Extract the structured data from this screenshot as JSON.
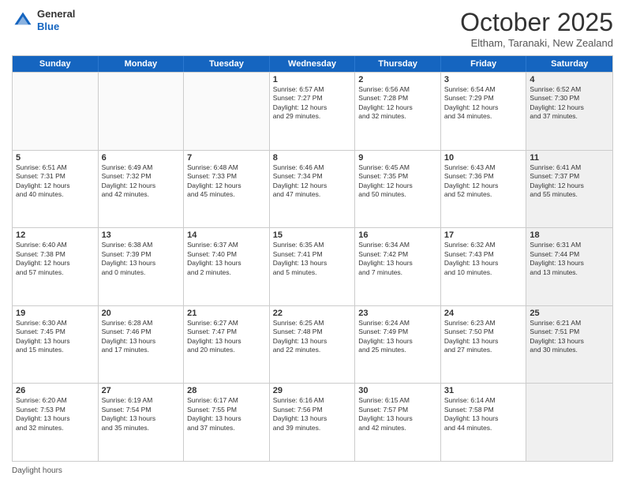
{
  "header": {
    "logo_general": "General",
    "logo_blue": "Blue",
    "month_title": "October 2025",
    "subtitle": "Eltham, Taranaki, New Zealand"
  },
  "days_of_week": [
    "Sunday",
    "Monday",
    "Tuesday",
    "Wednesday",
    "Thursday",
    "Friday",
    "Saturday"
  ],
  "footer_text": "Daylight hours",
  "weeks": [
    [
      {
        "day": "",
        "info": "",
        "empty": true
      },
      {
        "day": "",
        "info": "",
        "empty": true
      },
      {
        "day": "",
        "info": "",
        "empty": true
      },
      {
        "day": "1",
        "info": "Sunrise: 6:57 AM\nSunset: 7:27 PM\nDaylight: 12 hours\nand 29 minutes."
      },
      {
        "day": "2",
        "info": "Sunrise: 6:56 AM\nSunset: 7:28 PM\nDaylight: 12 hours\nand 32 minutes."
      },
      {
        "day": "3",
        "info": "Sunrise: 6:54 AM\nSunset: 7:29 PM\nDaylight: 12 hours\nand 34 minutes."
      },
      {
        "day": "4",
        "info": "Sunrise: 6:52 AM\nSunset: 7:30 PM\nDaylight: 12 hours\nand 37 minutes.",
        "shaded": true
      }
    ],
    [
      {
        "day": "5",
        "info": "Sunrise: 6:51 AM\nSunset: 7:31 PM\nDaylight: 12 hours\nand 40 minutes."
      },
      {
        "day": "6",
        "info": "Sunrise: 6:49 AM\nSunset: 7:32 PM\nDaylight: 12 hours\nand 42 minutes."
      },
      {
        "day": "7",
        "info": "Sunrise: 6:48 AM\nSunset: 7:33 PM\nDaylight: 12 hours\nand 45 minutes."
      },
      {
        "day": "8",
        "info": "Sunrise: 6:46 AM\nSunset: 7:34 PM\nDaylight: 12 hours\nand 47 minutes."
      },
      {
        "day": "9",
        "info": "Sunrise: 6:45 AM\nSunset: 7:35 PM\nDaylight: 12 hours\nand 50 minutes."
      },
      {
        "day": "10",
        "info": "Sunrise: 6:43 AM\nSunset: 7:36 PM\nDaylight: 12 hours\nand 52 minutes."
      },
      {
        "day": "11",
        "info": "Sunrise: 6:41 AM\nSunset: 7:37 PM\nDaylight: 12 hours\nand 55 minutes.",
        "shaded": true
      }
    ],
    [
      {
        "day": "12",
        "info": "Sunrise: 6:40 AM\nSunset: 7:38 PM\nDaylight: 12 hours\nand 57 minutes."
      },
      {
        "day": "13",
        "info": "Sunrise: 6:38 AM\nSunset: 7:39 PM\nDaylight: 13 hours\nand 0 minutes."
      },
      {
        "day": "14",
        "info": "Sunrise: 6:37 AM\nSunset: 7:40 PM\nDaylight: 13 hours\nand 2 minutes."
      },
      {
        "day": "15",
        "info": "Sunrise: 6:35 AM\nSunset: 7:41 PM\nDaylight: 13 hours\nand 5 minutes."
      },
      {
        "day": "16",
        "info": "Sunrise: 6:34 AM\nSunset: 7:42 PM\nDaylight: 13 hours\nand 7 minutes."
      },
      {
        "day": "17",
        "info": "Sunrise: 6:32 AM\nSunset: 7:43 PM\nDaylight: 13 hours\nand 10 minutes."
      },
      {
        "day": "18",
        "info": "Sunrise: 6:31 AM\nSunset: 7:44 PM\nDaylight: 13 hours\nand 13 minutes.",
        "shaded": true
      }
    ],
    [
      {
        "day": "19",
        "info": "Sunrise: 6:30 AM\nSunset: 7:45 PM\nDaylight: 13 hours\nand 15 minutes."
      },
      {
        "day": "20",
        "info": "Sunrise: 6:28 AM\nSunset: 7:46 PM\nDaylight: 13 hours\nand 17 minutes."
      },
      {
        "day": "21",
        "info": "Sunrise: 6:27 AM\nSunset: 7:47 PM\nDaylight: 13 hours\nand 20 minutes."
      },
      {
        "day": "22",
        "info": "Sunrise: 6:25 AM\nSunset: 7:48 PM\nDaylight: 13 hours\nand 22 minutes."
      },
      {
        "day": "23",
        "info": "Sunrise: 6:24 AM\nSunset: 7:49 PM\nDaylight: 13 hours\nand 25 minutes."
      },
      {
        "day": "24",
        "info": "Sunrise: 6:23 AM\nSunset: 7:50 PM\nDaylight: 13 hours\nand 27 minutes."
      },
      {
        "day": "25",
        "info": "Sunrise: 6:21 AM\nSunset: 7:51 PM\nDaylight: 13 hours\nand 30 minutes.",
        "shaded": true
      }
    ],
    [
      {
        "day": "26",
        "info": "Sunrise: 6:20 AM\nSunset: 7:53 PM\nDaylight: 13 hours\nand 32 minutes."
      },
      {
        "day": "27",
        "info": "Sunrise: 6:19 AM\nSunset: 7:54 PM\nDaylight: 13 hours\nand 35 minutes."
      },
      {
        "day": "28",
        "info": "Sunrise: 6:17 AM\nSunset: 7:55 PM\nDaylight: 13 hours\nand 37 minutes."
      },
      {
        "day": "29",
        "info": "Sunrise: 6:16 AM\nSunset: 7:56 PM\nDaylight: 13 hours\nand 39 minutes."
      },
      {
        "day": "30",
        "info": "Sunrise: 6:15 AM\nSunset: 7:57 PM\nDaylight: 13 hours\nand 42 minutes."
      },
      {
        "day": "31",
        "info": "Sunrise: 6:14 AM\nSunset: 7:58 PM\nDaylight: 13 hours\nand 44 minutes."
      },
      {
        "day": "",
        "info": "",
        "empty": true,
        "shaded": true
      }
    ]
  ]
}
